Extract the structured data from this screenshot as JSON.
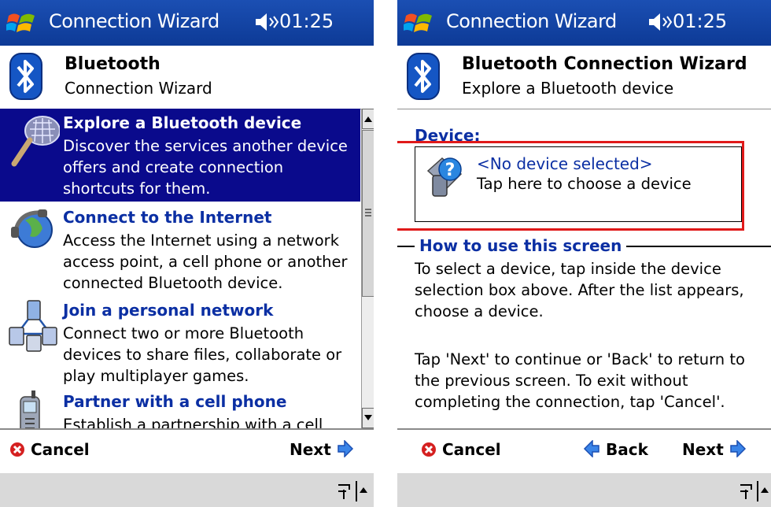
{
  "left": {
    "titlebar": {
      "title": "Connection Wizard",
      "time": "01:25"
    },
    "header": {
      "title": "Bluetooth",
      "subtitle": "Connection Wizard"
    },
    "items": [
      {
        "title": "Explore a Bluetooth device",
        "description": "Discover the services another device offers and create connection shortcuts for them.",
        "icon": "magnifier-icon",
        "selected": true
      },
      {
        "title": "Connect to the Internet",
        "description": "Access the Internet using a network access point, a cell phone or another connected Bluetooth device.",
        "icon": "globe-phone-icon"
      },
      {
        "title": "Join a personal network",
        "description": "Connect two or more Bluetooth devices to share files, collaborate or play multiplayer games.",
        "icon": "network-devices-icon"
      },
      {
        "title": "Partner with a cell phone",
        "description": "Establish a partnership with a cell",
        "icon": "cell-phone-icon"
      }
    ],
    "commands": {
      "cancel": "Cancel",
      "next": "Next"
    }
  },
  "right": {
    "titlebar": {
      "title": "Connection Wizard",
      "time": "01:25"
    },
    "header": {
      "title": "Bluetooth Connection Wizard",
      "subtitle": "Explore a Bluetooth device"
    },
    "device_label": "Device:",
    "device_box": {
      "title": "<No device selected>",
      "hint": "Tap here to choose a device"
    },
    "how_title": "How to use this screen",
    "paragraph1": "To select a device, tap inside the device selection box above. After the list appears, choose a device.",
    "paragraph2": "Tap 'Next' to continue or 'Back' to return to the previous screen. To exit without completing the connection, tap 'Cancel'.",
    "commands": {
      "cancel": "Cancel",
      "back": "Back",
      "next": "Next"
    }
  },
  "colors": {
    "titlebar": "#1b4fb3",
    "selection": "#0a0a8c",
    "link_blue": "#0b2fa3",
    "highlight_red": "#e01a1a",
    "cancel_red": "#d52020"
  }
}
